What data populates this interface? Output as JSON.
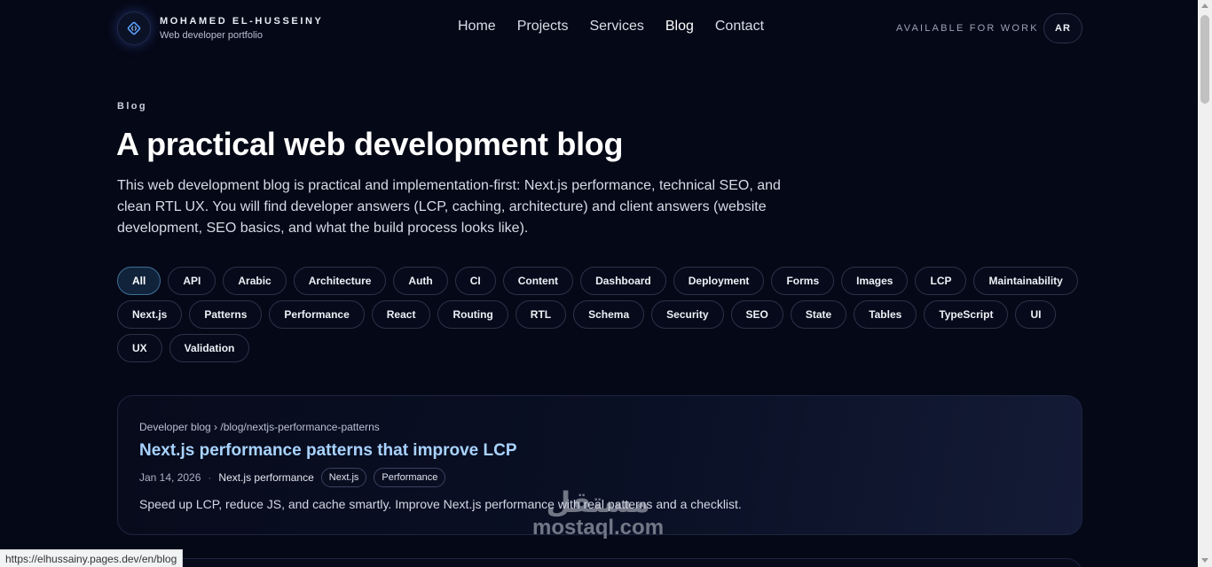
{
  "brand": {
    "name": "MOHAMED EL-HUSSEINY",
    "subtitle": "Web developer portfolio",
    "logo_icon": "code-diamond-icon"
  },
  "nav": [
    {
      "label": "Home",
      "active": false
    },
    {
      "label": "Projects",
      "active": false
    },
    {
      "label": "Services",
      "active": false
    },
    {
      "label": "Blog",
      "active": true
    },
    {
      "label": "Contact",
      "active": false
    }
  ],
  "header": {
    "availability": "AVAILABLE FOR WORK",
    "lang_toggle": "AR"
  },
  "hero": {
    "eyebrow": "Blog",
    "title": "A practical web development blog",
    "lede": "This web development blog is practical and implementation-first: Next.js performance, technical SEO, and clean RTL UX. You will find developer answers (LCP, caching, architecture) and client answers (website development, SEO basics, and what the build process looks like)."
  },
  "tags": [
    {
      "label": "All",
      "active": true
    },
    {
      "label": "API"
    },
    {
      "label": "Arabic"
    },
    {
      "label": "Architecture"
    },
    {
      "label": "Auth"
    },
    {
      "label": "CI"
    },
    {
      "label": "Content"
    },
    {
      "label": "Dashboard"
    },
    {
      "label": "Deployment"
    },
    {
      "label": "Forms"
    },
    {
      "label": "Images"
    },
    {
      "label": "LCP"
    },
    {
      "label": "Maintainability"
    },
    {
      "label": "Next.js"
    },
    {
      "label": "Patterns"
    },
    {
      "label": "Performance"
    },
    {
      "label": "React"
    },
    {
      "label": "Routing"
    },
    {
      "label": "RTL"
    },
    {
      "label": "Schema"
    },
    {
      "label": "Security"
    },
    {
      "label": "SEO"
    },
    {
      "label": "State"
    },
    {
      "label": "Tables"
    },
    {
      "label": "TypeScript"
    },
    {
      "label": "UI"
    },
    {
      "label": "UX"
    },
    {
      "label": "Validation"
    }
  ],
  "post": {
    "breadcrumb": "Developer blog › /blog/nextjs-performance-patterns",
    "title": "Next.js performance patterns that improve LCP",
    "date": "Jan 14, 2026",
    "separator": "·",
    "category": "Next.js performance",
    "tags": [
      "Next.js",
      "Performance"
    ],
    "excerpt": "Speed up LCP, reduce JS, and cache smartly. Improve Next.js performance with real patterns and a checklist."
  },
  "watermark": {
    "arabic": "مستقل",
    "latin": "mostaql.com"
  },
  "status_url": "https://elhussainy.pages.dev/en/blog",
  "colors": {
    "background": "#050816",
    "accent": "#a9d3ff",
    "active_tag_bg": "#10233b"
  }
}
